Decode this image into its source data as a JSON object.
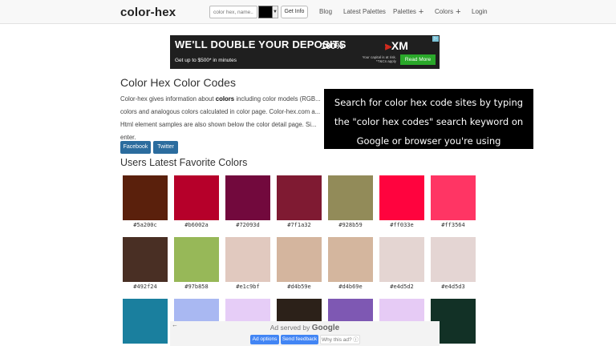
{
  "navbar": {
    "brand": "color-hex",
    "search_placeholder": "color hex, name..",
    "get_info_label": "Get Info",
    "links": {
      "blog": "Blog",
      "latest_palettes": "Latest Palettes",
      "palettes": "Palettes",
      "colors": "Colors",
      "login": "Login"
    },
    "plus_glyph": "+"
  },
  "top_ad": {
    "headline": "WE'LL DOUBLE YOUR DEPOSITS",
    "subline": "Get up to $500* in minutes",
    "percent": "100%",
    "brand": "XM",
    "risk": "Your capital is at risk. *T&Cs apply",
    "cta": "Read More"
  },
  "main": {
    "title": "Color Hex Color Codes",
    "intro_before": "Color-hex gives information about ",
    "intro_bold": "colors",
    "intro_after": " including color models (RGB... colors and analogous colors calculated in color page. Color-hex.com a... Html element samples are also shown below the color detail page. Si... enter.",
    "facebook_label": "Facebook",
    "twitter_label": "Twitter",
    "favorites_heading": "Users Latest Favorite Colors"
  },
  "caption": {
    "lines": [
      "Search for color hex code sites by typing",
      "the \"color hex codes\" search keyword on",
      "Google or browser you're using"
    ]
  },
  "favorite_colors": [
    {
      "hex": "#5a200c",
      "label": "#5a200c"
    },
    {
      "hex": "#b6002a",
      "label": "#b6002a"
    },
    {
      "hex": "#72093d",
      "label": "#72093d"
    },
    {
      "hex": "#7f1a32",
      "label": "#7f1a32"
    },
    {
      "hex": "#928b59",
      "label": "#928b59"
    },
    {
      "hex": "#ff033e",
      "label": "#ff033e"
    },
    {
      "hex": "#ff3564",
      "label": "#ff3564"
    },
    {
      "hex": "#492f24",
      "label": "#492f24"
    },
    {
      "hex": "#97b858",
      "label": "#97b858"
    },
    {
      "hex": "#e1c9bf",
      "label": "#e1c9bf"
    },
    {
      "hex": "#d4b59e",
      "label": "#d4b59e"
    },
    {
      "hex": "#d4b69e",
      "label": "#d4b69e"
    },
    {
      "hex": "#e4d5d2",
      "label": "#e4d5d2"
    },
    {
      "hex": "#e4d5d3",
      "label": "#e4d5d3"
    },
    {
      "hex": "#1a7f9e",
      "label": ""
    },
    {
      "hex": "#a9b8f2",
      "label": ""
    },
    {
      "hex": "#e6cdf7",
      "label": ""
    },
    {
      "hex": "#2c2119",
      "label": ""
    },
    {
      "hex": "#7e58b3",
      "label": ""
    },
    {
      "hex": "#e6cbf5",
      "label": ""
    },
    {
      "hex": "#123126",
      "label": ""
    }
  ],
  "bottom_ad": {
    "back_glyph": "←",
    "served_by": "Ad served by",
    "google": "Google",
    "ad_options": "Ad options",
    "send_feedback": "Send feedback",
    "why_this_ad": "Why this ad? ⓘ"
  }
}
